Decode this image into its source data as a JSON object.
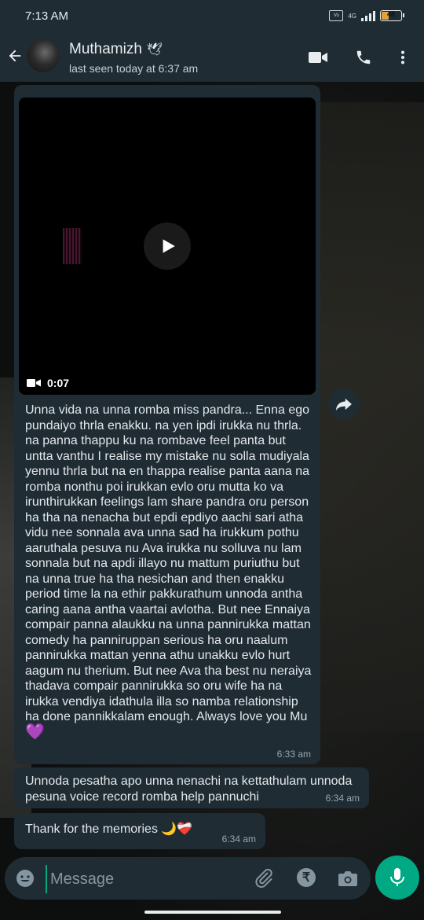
{
  "status_bar": {
    "time": "7:13 AM",
    "network": "4G",
    "battery": "48",
    "battery_color": "#e2a23c"
  },
  "header": {
    "contact_name": "Muthamizh",
    "contact_emoji": "🕊",
    "last_seen": "last seen today at 6:37 am",
    "icons": [
      "back-arrow-icon",
      "video-call-icon",
      "phone-call-icon",
      "more-options-icon"
    ]
  },
  "messages": [
    {
      "type": "video",
      "duration": "0:07",
      "text": "Unna vida na unna romba miss pandra... Enna ego pundaiyo thrla enakku. na yen ipdi irukka nu thrla. na panna thappu ku na rombave feel panta but untta vanthu I realise my mistake nu solla mudiyala yennu thrla but na en thappa realise panta aana na romba nonthu poi irukkan evlo oru mutta ko va irunthirukkan feelings lam share pandra oru person ha tha na nenacha but epdi epdiyo aachi sari atha vidu nee sonnala ava unna sad ha irukkum pothu aaruthala pesuva nu Ava irukka nu solluva nu lam sonnala but na apdi illayo nu mattum puriuthu but na unna true ha tha nesichan and then enakku period time la na ethir pakkurathum unnoda antha caring aana antha vaartai avlotha. But nee Ennaiya compair panna alaukku na unna pannirukka mattan comedy ha panniruppan serious ha oru naalum pannirukka mattan yenna athu unakku evlo hurt aagum nu therium. But nee Ava tha best nu neraiya thadava compair pannirukka so oru wife ha na irukka vendiya idathula illa so namba relationship ha done pannikkalam enough. Always love you Mu",
      "emoji": "💜",
      "time": "6:33 am"
    },
    {
      "type": "text",
      "text": "Unnoda pesatha apo unna nenachi na kettathulam unnoda pesuna voice record romba help pannuchi",
      "time": "6:34 am"
    },
    {
      "type": "text",
      "text": "Thank for the memories 🌙❤️‍🩹",
      "time": "6:34 am"
    }
  ],
  "input": {
    "placeholder": "Message",
    "value": "",
    "icons": [
      "emoji-icon",
      "attach-icon",
      "rupee-icon",
      "camera-icon",
      "mic-icon"
    ]
  },
  "colors": {
    "bar_bg": "#1f2c34",
    "bubble_bg": "#1f2c34",
    "accent": "#00a884"
  }
}
